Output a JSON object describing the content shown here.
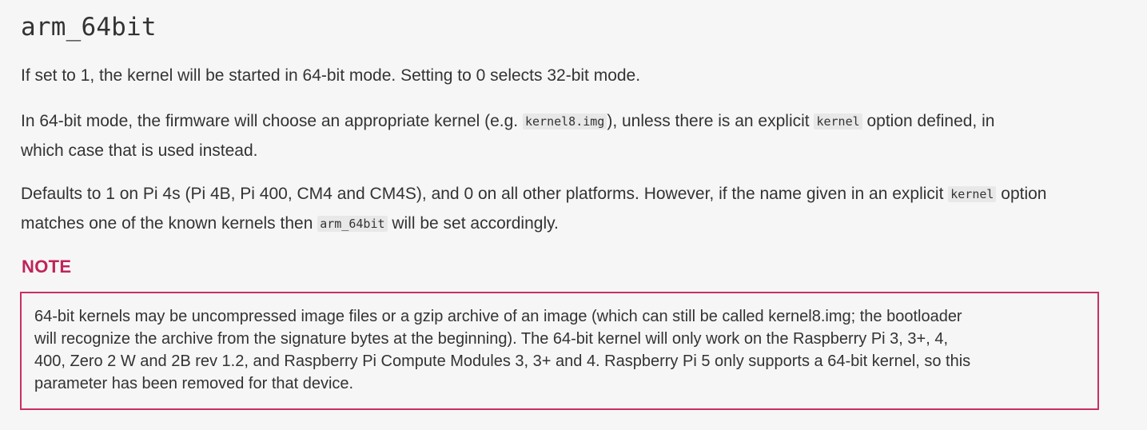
{
  "heading": "arm_64bit",
  "p1": "If set to 1, the kernel will be started in 64-bit mode. Setting to 0 selects 32-bit mode.",
  "p2": {
    "seg1": "In 64-bit mode, the firmware will choose an appropriate kernel (e.g. ",
    "code1": "kernel8.img",
    "seg2": "), unless there is an explicit ",
    "code2": "kernel",
    "seg3": " option defined, in",
    "seg4": "which case that is used instead."
  },
  "p3": {
    "seg1": "Defaults to 1 on Pi 4s (Pi 4B, Pi 400, CM4 and CM4S), and 0 on all other platforms. However, if the name given in an explicit ",
    "code1": "kernel",
    "seg2": " option",
    "seg3": "matches one of the known kernels then ",
    "code2": "arm_64bit",
    "seg4": " will be set accordingly."
  },
  "note": {
    "label": "NOTE",
    "lines": [
      "64-bit kernels may be uncompressed image files or a gzip archive of an image (which can still be called kernel8.img; the bootloader",
      "will recognize the archive from the signature bytes at the beginning). The 64-bit kernel will only work on the Raspberry Pi 3, 3+, 4,",
      "400, Zero 2 W and 2B rev 1.2, and Raspberry Pi Compute Modules 3, 3+ and 4. Raspberry Pi 5 only supports a 64-bit kernel, so this",
      "parameter has been removed for that device."
    ]
  }
}
